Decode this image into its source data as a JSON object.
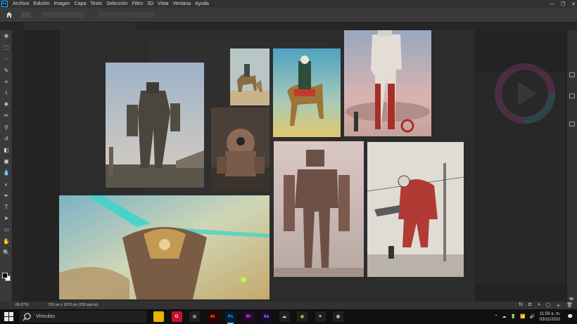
{
  "app": {
    "logo": "Ps",
    "menu": [
      "Archivo",
      "Edición",
      "Imagen",
      "Capa",
      "Texto",
      "Selección",
      "Filtro",
      "3D",
      "Vista",
      "Ventana",
      "Ayuda"
    ],
    "window_controls": [
      "—",
      "❐",
      "✕"
    ]
  },
  "tools": [
    {
      "name": "move-tool-icon",
      "glyph": "✥"
    },
    {
      "name": "marquee-tool-icon",
      "glyph": "⬚"
    },
    {
      "name": "lasso-tool-icon",
      "glyph": "◌"
    },
    {
      "name": "quick-select-tool-icon",
      "glyph": "✎"
    },
    {
      "name": "crop-tool-icon",
      "glyph": "⌗"
    },
    {
      "name": "eyedropper-tool-icon",
      "glyph": "⌇"
    },
    {
      "name": "healing-brush-tool-icon",
      "glyph": "✚"
    },
    {
      "name": "brush-tool-icon",
      "glyph": "✏"
    },
    {
      "name": "clone-stamp-tool-icon",
      "glyph": "⚲"
    },
    {
      "name": "history-brush-tool-icon",
      "glyph": "↺"
    },
    {
      "name": "eraser-tool-icon",
      "glyph": "◧"
    },
    {
      "name": "gradient-tool-icon",
      "glyph": "▣"
    },
    {
      "name": "blur-tool-icon",
      "glyph": "💧"
    },
    {
      "name": "dodge-tool-icon",
      "glyph": "◐"
    },
    {
      "name": "pen-tool-icon",
      "glyph": "✒"
    },
    {
      "name": "type-tool-icon",
      "glyph": "T"
    },
    {
      "name": "path-select-tool-icon",
      "glyph": "➤"
    },
    {
      "name": "shape-tool-icon",
      "glyph": "▭"
    },
    {
      "name": "hand-tool-icon",
      "glyph": "✋"
    },
    {
      "name": "zoom-tool-icon",
      "glyph": "🔍"
    }
  ],
  "status": {
    "zoom": "66,67%",
    "doc_info": "720 px x 1070 px (250 ppcm)",
    "layer_buttons": [
      "fx",
      "◘",
      "◑",
      "▢",
      "＋",
      "🗑"
    ]
  },
  "taskbar": {
    "search_placeholder": "Vínculos",
    "apps": [
      {
        "name": "file-explorer-icon",
        "label": "",
        "bg": "#e8b400",
        "fg": "#000"
      },
      {
        "name": "opera-icon",
        "label": "O",
        "bg": "#c8102e",
        "fg": "#fff"
      },
      {
        "name": "app-icon",
        "label": "◎",
        "bg": "#202020",
        "fg": "#ddd"
      },
      {
        "name": "illustrator-icon",
        "label": "Ai",
        "bg": "#330000",
        "fg": "#ff9a00"
      },
      {
        "name": "photoshop-icon",
        "label": "Ps",
        "bg": "#001e36",
        "fg": "#31a8ff"
      },
      {
        "name": "premiere-icon",
        "label": "Pr",
        "bg": "#2a0634",
        "fg": "#ea77ff"
      },
      {
        "name": "after-effects-icon",
        "label": "Ae",
        "bg": "#1a0a33",
        "fg": "#9999ff"
      },
      {
        "name": "app-icon",
        "label": "☁",
        "bg": "#202020",
        "fg": "#ddd"
      },
      {
        "name": "app-icon",
        "label": "◉",
        "bg": "#202020",
        "fg": "#7fd35a"
      },
      {
        "name": "app-icon",
        "label": "✦",
        "bg": "#202020",
        "fg": "#ddd"
      },
      {
        "name": "app-icon",
        "label": "◍",
        "bg": "#202020",
        "fg": "#ddd"
      }
    ],
    "tray_icons": [
      "⌃",
      "☁",
      "🔋",
      "📶",
      "🔊"
    ],
    "time": "11:59 a. m.",
    "date": "03/11/2021",
    "notification": "💬"
  }
}
